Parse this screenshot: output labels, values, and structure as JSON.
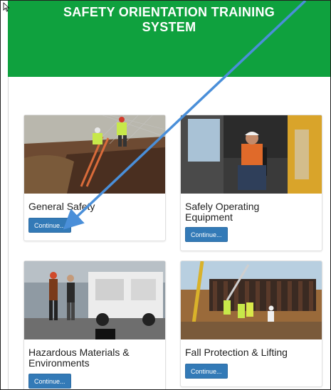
{
  "header": {
    "title_line1": "SAFETY ORIENTATION TRAINING",
    "title_line2": "SYSTEM",
    "background_color": "#0fa13e"
  },
  "modules": [
    {
      "title": "General Safety",
      "button_label": "Continue...",
      "image": "trench-workers-photo"
    },
    {
      "title_line1": "Safely Operating",
      "title_line2": "Equipment",
      "button_label": "Continue...",
      "image": "equipment-operator-photo"
    },
    {
      "title_line1": "Hazardous Materials &",
      "title_line2": "Environments",
      "button_label": "Continue...",
      "image": "utility-truck-photo"
    },
    {
      "title": "Fall Protection & Lifting",
      "button_label": "Continue...",
      "image": "construction-site-photo"
    }
  ],
  "annotation": {
    "arrow_color": "#4a8fd9"
  },
  "accent_color": "#337ab7"
}
